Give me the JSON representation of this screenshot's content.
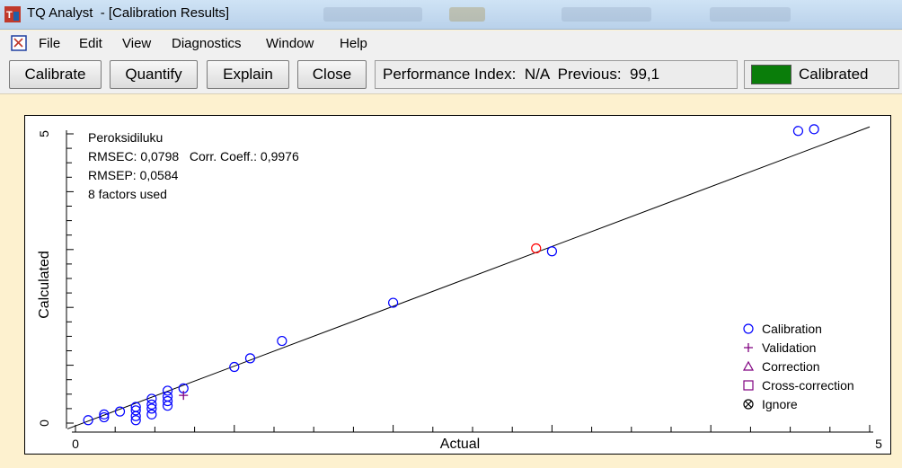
{
  "window": {
    "app_name": "TQ Analyst",
    "document_title": "[Calibration Results]"
  },
  "menu": {
    "items": [
      "File",
      "Edit",
      "View",
      "Diagnostics",
      "Window",
      "Help"
    ]
  },
  "toolbar": {
    "calibrate_label": "Calibrate",
    "quantify_label": "Quantify",
    "explain_label": "Explain",
    "close_label": "Close",
    "performance_label": "Performance Index:",
    "performance_value": "N/A",
    "previous_label": "Previous:",
    "previous_value": "99,1",
    "status_label": "Calibrated",
    "status_color": "#0a7d0a"
  },
  "plot": {
    "stats": {
      "component": "Peroksidiluku",
      "rmsec_line": "RMSEC: 0,0798   Corr. Coeff.: 0,9976",
      "rmsep_line": "RMSEP: 0,0584",
      "factors_line": "8 factors used"
    }
  },
  "chart_data": {
    "type": "scatter",
    "xlabel": "Actual",
    "ylabel": "Calculated",
    "xlim": [
      0,
      5
    ],
    "ylim": [
      0,
      5
    ],
    "x_tick_labels": [
      "0",
      "5"
    ],
    "y_tick_labels": [
      "0",
      "5"
    ],
    "regression_line": {
      "x": [
        -0.05,
        5.0
      ],
      "y": [
        -0.1,
        5.12
      ]
    },
    "legend": [
      "Calibration",
      "Validation",
      "Correction",
      "Cross-correction",
      "Ignore"
    ],
    "legend_position": "bottom-right",
    "series": [
      {
        "name": "Calibration",
        "marker": "circle",
        "color": "#0000ff",
        "points": [
          [
            0.08,
            0.05
          ],
          [
            0.18,
            0.1
          ],
          [
            0.18,
            0.15
          ],
          [
            0.28,
            0.2
          ],
          [
            0.38,
            0.05
          ],
          [
            0.38,
            0.12
          ],
          [
            0.38,
            0.22
          ],
          [
            0.38,
            0.28
          ],
          [
            0.48,
            0.15
          ],
          [
            0.48,
            0.25
          ],
          [
            0.48,
            0.32
          ],
          [
            0.48,
            0.42
          ],
          [
            0.58,
            0.3
          ],
          [
            0.58,
            0.38
          ],
          [
            0.58,
            0.46
          ],
          [
            0.58,
            0.56
          ],
          [
            0.68,
            0.6
          ],
          [
            1.0,
            0.97
          ],
          [
            1.1,
            1.12
          ],
          [
            1.3,
            1.42
          ],
          [
            2.0,
            2.08
          ],
          [
            3.0,
            2.97
          ],
          [
            4.55,
            5.05
          ],
          [
            4.65,
            5.08
          ]
        ]
      },
      {
        "name": "Validation",
        "marker": "plus",
        "color": "#800080",
        "points": [
          [
            0.68,
            0.48
          ]
        ]
      },
      {
        "name": "",
        "marker": "circle",
        "color": "#ff0000",
        "points": [
          [
            2.9,
            3.02
          ]
        ]
      }
    ]
  }
}
